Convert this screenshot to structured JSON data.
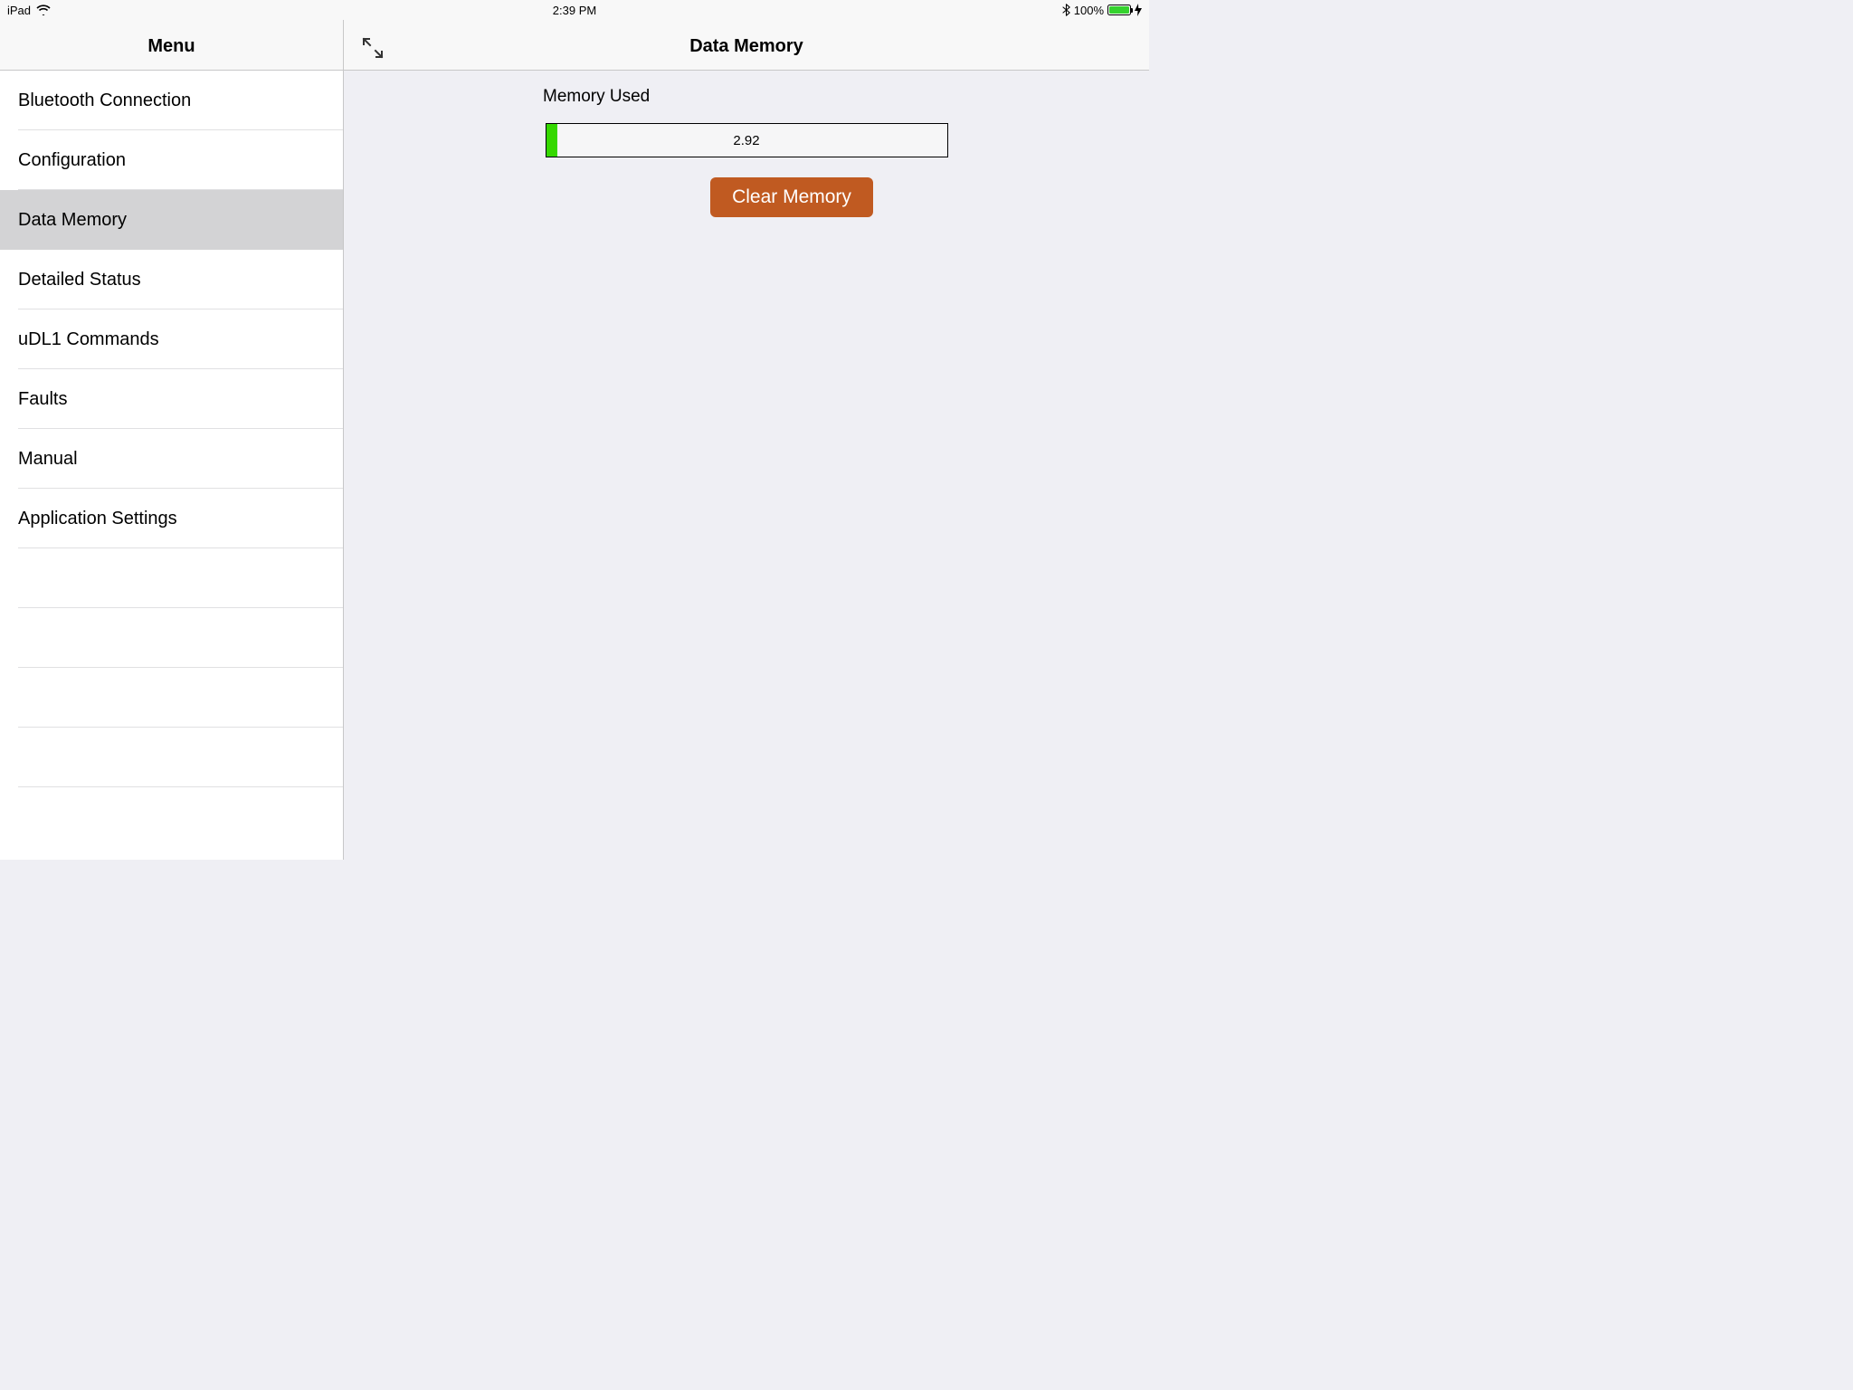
{
  "statusBar": {
    "device": "iPad",
    "time": "2:39 PM",
    "batteryPercent": "100%",
    "batteryFill": 100
  },
  "sidebar": {
    "title": "Menu",
    "items": [
      {
        "label": "Bluetooth Connection",
        "selected": false
      },
      {
        "label": "Configuration",
        "selected": false
      },
      {
        "label": "Data Memory",
        "selected": true
      },
      {
        "label": "Detailed Status",
        "selected": false
      },
      {
        "label": "uDL1 Commands",
        "selected": false
      },
      {
        "label": "Faults",
        "selected": false
      },
      {
        "label": "Manual",
        "selected": false
      },
      {
        "label": "Application Settings",
        "selected": false
      }
    ],
    "emptyRows": 4
  },
  "content": {
    "title": "Data Memory",
    "memoryUsedLabel": "Memory Used",
    "memoryUsedValue": "2.92",
    "memoryUsedPercent": 2.92,
    "clearButton": "Clear Memory"
  },
  "colors": {
    "accent": "#c05a21",
    "progressFill": "#35d800",
    "batteryFill": "#35d22e"
  }
}
